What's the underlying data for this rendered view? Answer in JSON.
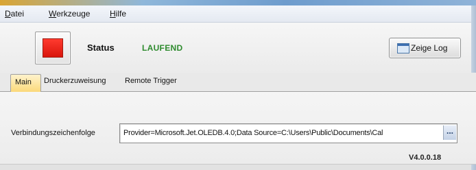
{
  "menu": {
    "items": [
      "Datei",
      "Werkzeuge",
      "Hilfe"
    ]
  },
  "status": {
    "label": "Status",
    "value": "LAUFEND",
    "value_color": "#2e8b2e",
    "stop_color": "#e0160c"
  },
  "toolbar": {
    "log_button_label": "Zeige Log"
  },
  "tabs": [
    {
      "label": "Main",
      "active": true
    },
    {
      "label": "Druckerzuweisung",
      "active": false
    },
    {
      "label": "Remote Trigger",
      "active": false
    }
  ],
  "connection": {
    "label": "Verbindungszeichenfolge",
    "value": "Provider=Microsoft.Jet.OLEDB.4.0;Data Source=C:\\Users\\Public\\Documents\\Cal",
    "browse_label": "..."
  },
  "footer": {
    "version": "V4.0.0.18"
  }
}
